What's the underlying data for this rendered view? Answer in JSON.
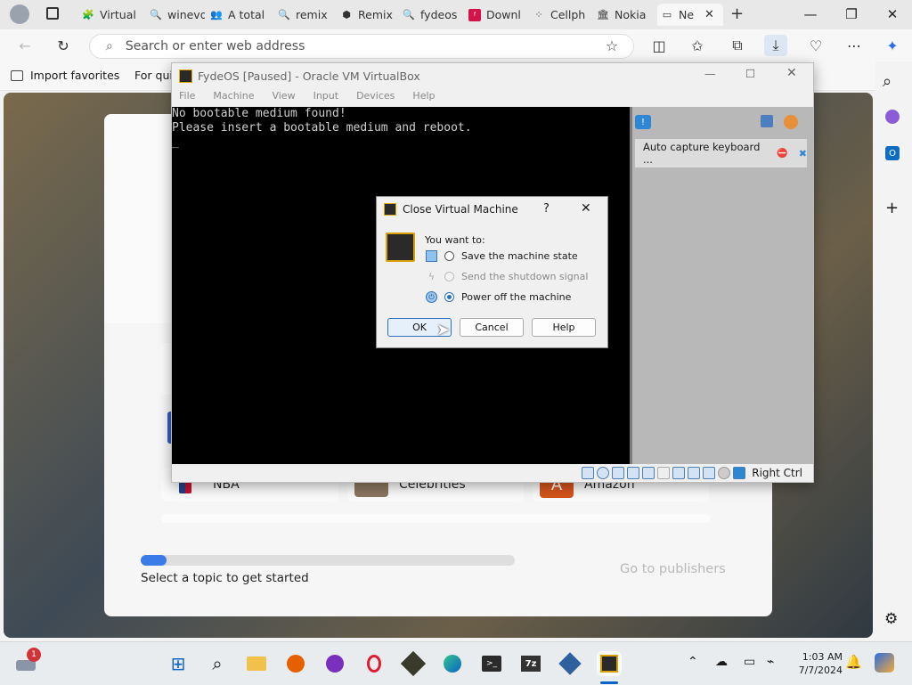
{
  "browser": {
    "tabs": [
      {
        "title": "Virtual"
      },
      {
        "title": "winevd"
      },
      {
        "title": "A total"
      },
      {
        "title": "remix"
      },
      {
        "title": "Remix"
      },
      {
        "title": "fydeos"
      },
      {
        "title": "Downl"
      },
      {
        "title": "Cellph"
      },
      {
        "title": "Nokia"
      },
      {
        "title": "Ne"
      }
    ],
    "address_placeholder": "Search or enter web address",
    "favorites": {
      "import": "Import favorites",
      "quick": "For quick"
    }
  },
  "page": {
    "chips": [
      "NBA",
      "Celebrities",
      "Amazon"
    ],
    "amazon_letter": "A",
    "progress_fraction": 0.07,
    "topic_prompt": "Select a topic to get started",
    "publishers_link": "Go to publishers"
  },
  "vbox": {
    "title": "FydeOS [Paused] - Oracle VM VirtualBox",
    "menu": [
      "File",
      "Machine",
      "View",
      "Input",
      "Devices",
      "Help"
    ],
    "screen_lines": [
      "No bootable medium found!",
      "Please insert a bootable medium and reboot.",
      "_"
    ],
    "side_notice": "Auto capture keyboard ...",
    "host_key": "Right Ctrl"
  },
  "dialog": {
    "title": "Close Virtual Machine",
    "help_glyph": "?",
    "prompt": "You want to:",
    "options": [
      {
        "label": "Save the machine state",
        "selected": false,
        "enabled": true
      },
      {
        "label": "Send the shutdown signal",
        "selected": false,
        "enabled": false
      },
      {
        "label": "Power off the machine",
        "selected": true,
        "enabled": true
      }
    ],
    "buttons": {
      "ok": "OK",
      "cancel": "Cancel",
      "help": "Help"
    }
  },
  "taskbar": {
    "notification_count": "1",
    "time": "1:03 AM",
    "date": "7/7/2024",
    "app_7z": "7z"
  },
  "colors": {
    "accent": "#3b7be8",
    "edge_active": "#0a64c8"
  }
}
